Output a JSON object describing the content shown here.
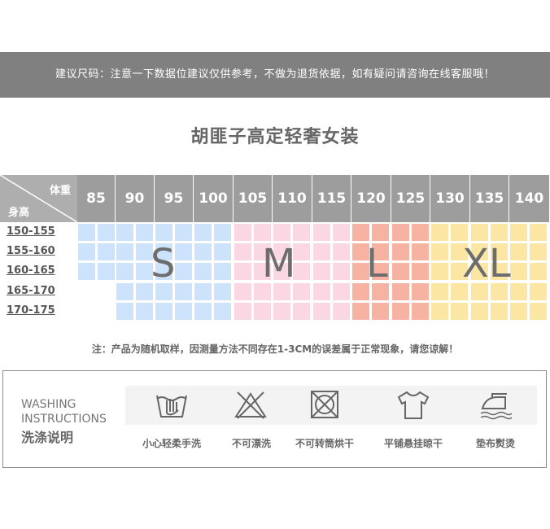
{
  "banner": {
    "text": "建议尺码：注意一下数据位建议仅供参考，不做为退货依据，如有疑问请咨询在线客服哦！"
  },
  "title": "胡匪子高定轻奢女装",
  "size_table": {
    "weight_label": "体重",
    "height_label": "身高",
    "weights": [
      "85",
      "90",
      "95",
      "100",
      "105",
      "110",
      "115",
      "120",
      "125",
      "130",
      "135",
      "140"
    ],
    "heights": [
      "150-155",
      "155-160",
      "160-165",
      "165-170",
      "170-175"
    ],
    "sizes": [
      {
        "label": "S",
        "color": "#cce3fb"
      },
      {
        "label": "M",
        "color": "#fbd7e3"
      },
      {
        "label": "L",
        "color": "#f7b3a2"
      },
      {
        "label": "XL",
        "color": "#fbe7a3"
      }
    ]
  },
  "note": "注：产品为随机取样，因测量方法不同存在1-3CM的误差属于正常现象，请您谅解！",
  "washing": {
    "title_en_1": "WASHING",
    "title_en_2": "INSTRUCTIONS",
    "title_cn": "洗涤说明",
    "items": [
      {
        "label": "小心轻柔手洗",
        "icon": "hand-wash-icon"
      },
      {
        "label": "不可漂洗",
        "icon": "no-bleach-icon"
      },
      {
        "label": "不可转筒烘干",
        "icon": "no-tumble-dry-icon"
      },
      {
        "label": "平铺悬挂晾干",
        "icon": "hang-dry-icon"
      },
      {
        "label": "垫布熨烫",
        "icon": "iron-with-cloth-icon"
      }
    ]
  }
}
